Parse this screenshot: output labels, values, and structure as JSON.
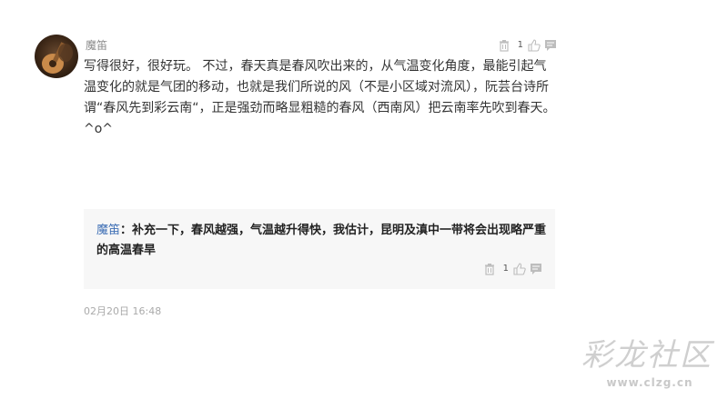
{
  "comment": {
    "username": "魔笛",
    "like_count": "1",
    "text": "写得很好，很好玩。 不过，春天真是春风吹出来的，从气温变化角度，最能引起气温变化的就是气团的移动，也就是我们所说的风（不是小区域对流风），阮芸台诗所谓“春风先到彩云南“，正是强劲而略显粗糙的春风（西南风）把云南率先吹到春天。 ^o^"
  },
  "reply": {
    "username": "魔笛",
    "text": "：补充一下，春风越强，气温越升得快，我估计，昆明及滇中一带将会出现略严重的高温春旱",
    "like_count": "1"
  },
  "timestamp": "02月20日 16:48",
  "watermark": {
    "title": "彩龙社区",
    "url": "www.clzg.cn"
  },
  "icons": {
    "delete": "trash-icon",
    "like": "thumbs-up-icon",
    "reply": "comment-bubble-icon"
  },
  "colors": {
    "link_blue": "#3e6fb5",
    "reply_bg": "#f7f7f7",
    "muted_text": "#aaaaaa"
  }
}
